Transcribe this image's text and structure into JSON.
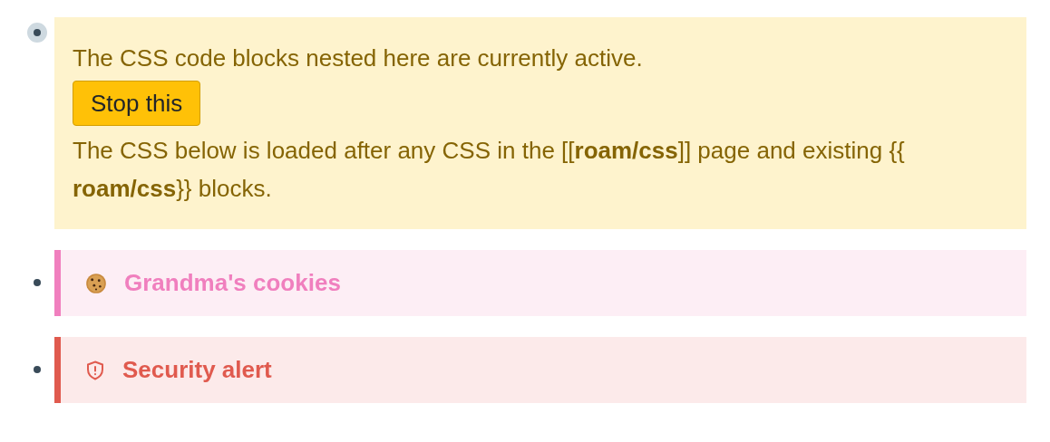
{
  "blocks": [
    {
      "kind": "notice",
      "collapsed": true,
      "message": "The CSS code blocks nested here are currently active.",
      "button": "Stop this",
      "note": "The CSS below is loaded after any CSS in the [[**roam/css**]] page and existing {{ **roam/css**}} blocks."
    },
    {
      "kind": "recipe",
      "collapsed": false,
      "color": "#f07fbe",
      "title": "Grandma's cookies"
    },
    {
      "kind": "alert",
      "collapsed": false,
      "color": "#e05a4e",
      "title": "Security alert"
    }
  ]
}
